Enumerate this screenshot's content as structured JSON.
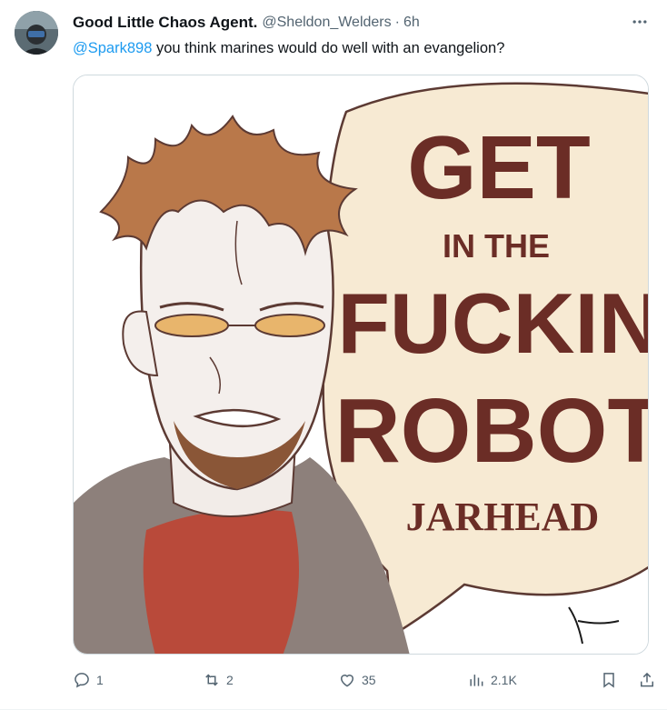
{
  "tweet": {
    "display_name": "Good Little Chaos Agent.",
    "handle": "@Sheldon_Welders",
    "separator": "·",
    "time": "6h",
    "more_icon": "ellipsis-icon",
    "mention": "@Spark898",
    "text": " you think marines would do well with an evangelion?"
  },
  "media": {
    "kind": "comic-image",
    "bubble_line1": "GET",
    "bubble_line2": "IN THE",
    "bubble_line3": "FUCKIN",
    "bubble_line4": "ROBOT",
    "bubble_line5": "JARHEAD",
    "colors": {
      "bubble": "#f7ead3",
      "lettering": "#6b2d26",
      "hair": "#b9784a",
      "glasses": "#e8b56c",
      "shirt": "#b94a3a",
      "coat": "#8d807b"
    }
  },
  "actions": {
    "reply": {
      "icon": "reply-icon",
      "count": "1"
    },
    "retweet": {
      "icon": "retweet-icon",
      "count": "2"
    },
    "like": {
      "icon": "heart-icon",
      "count": "35"
    },
    "views": {
      "icon": "analytics-icon",
      "count": "2.1K"
    },
    "bookmark": {
      "icon": "bookmark-icon"
    },
    "share": {
      "icon": "share-icon"
    }
  }
}
